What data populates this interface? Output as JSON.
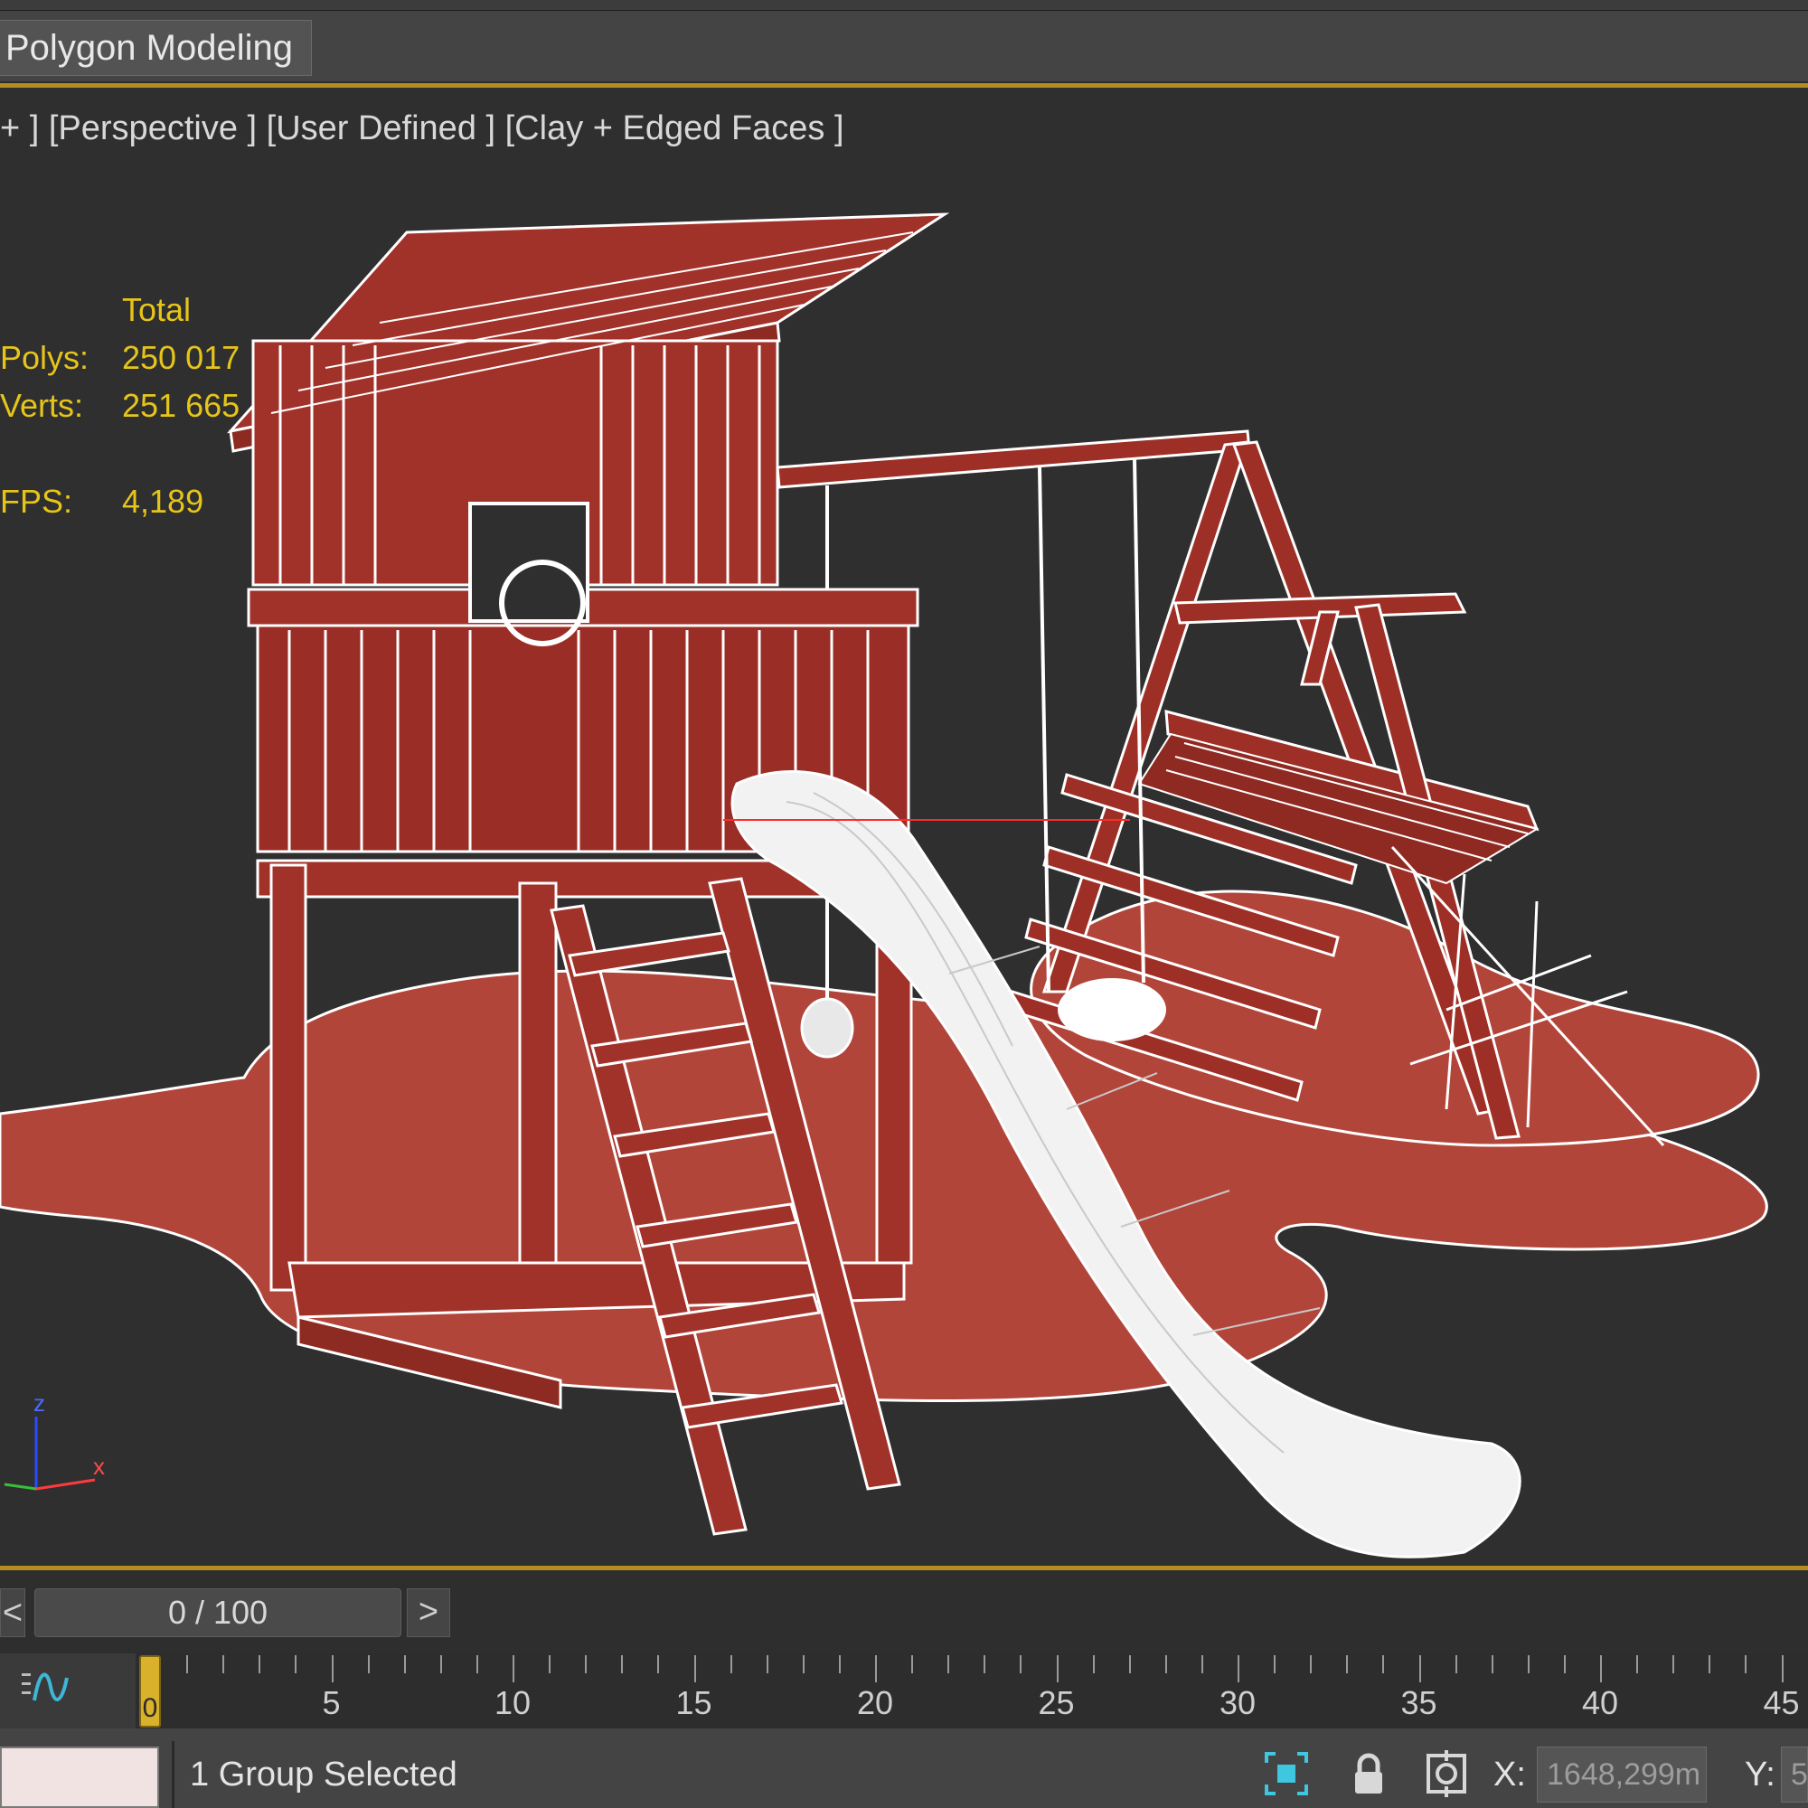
{
  "ribbon": {
    "tab_label": "Polygon Modeling"
  },
  "viewport": {
    "label": "+ ] [Perspective ] [User Defined ] [Clay + Edged Faces ]",
    "stats": {
      "header": "Total",
      "polys_label": "Polys:",
      "polys_value": "250 017",
      "verts_label": "Verts:",
      "verts_value": "251 665",
      "fps_label": "FPS:",
      "fps_value": "4,189"
    },
    "axis": {
      "z": "z",
      "x": "x"
    }
  },
  "time_slider": {
    "prev": "<",
    "frame": "0 / 100",
    "next": ">"
  },
  "track_bar": {
    "current_frame": "0",
    "labels": [
      "5",
      "10",
      "15",
      "20",
      "25",
      "30",
      "35",
      "40",
      "45"
    ]
  },
  "status": {
    "text": "1 Group Selected",
    "x_label": "X:",
    "x_value": "1648,299m",
    "y_label": "Y:",
    "y_value": "5"
  },
  "colors": {
    "accent_line": "#b38d1f",
    "model_red": "#b2453a",
    "stats_yellow": "#e6c51a"
  }
}
